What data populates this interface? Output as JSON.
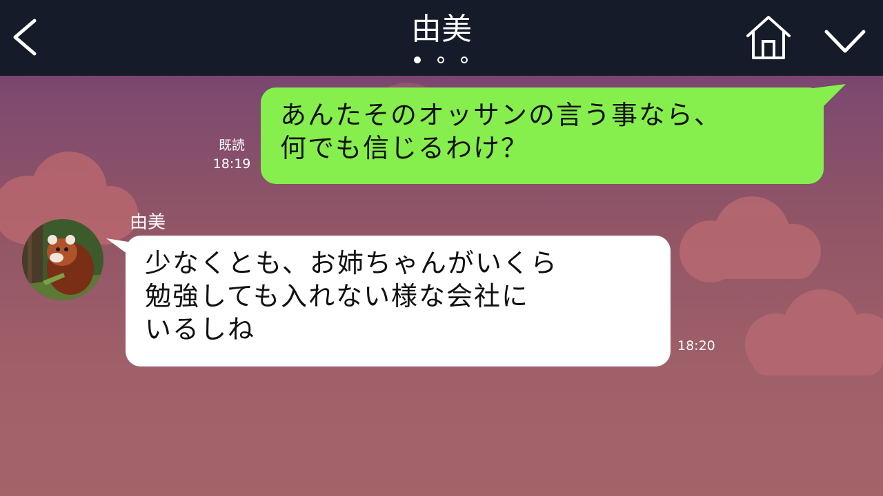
{
  "header": {
    "title": "由美",
    "page_count": 3,
    "active_page": 1
  },
  "messages": [
    {
      "direction": "outgoing",
      "lines": [
        "あんたそのオッサンの言う事なら、",
        "何でも信じるわけ？"
      ],
      "read_status": "既読",
      "time": "18:19"
    },
    {
      "direction": "incoming",
      "sender": "由美",
      "lines": [
        "少なくとも、お姉ちゃんがいくら",
        "勉強しても入れない様な会社に",
        "いるしね"
      ],
      "time": "18:20"
    }
  ],
  "icons": {
    "back": "chevron-left-icon",
    "home": "home-icon",
    "menu": "chevron-down-icon",
    "avatar": "red-panda-avatar"
  },
  "colors": {
    "header_bg": "#161b29",
    "outgoing_bubble": "#86ef4d",
    "incoming_bubble": "#ffffff",
    "background_top": "#6d3a73",
    "background_bottom": "#a26369"
  }
}
